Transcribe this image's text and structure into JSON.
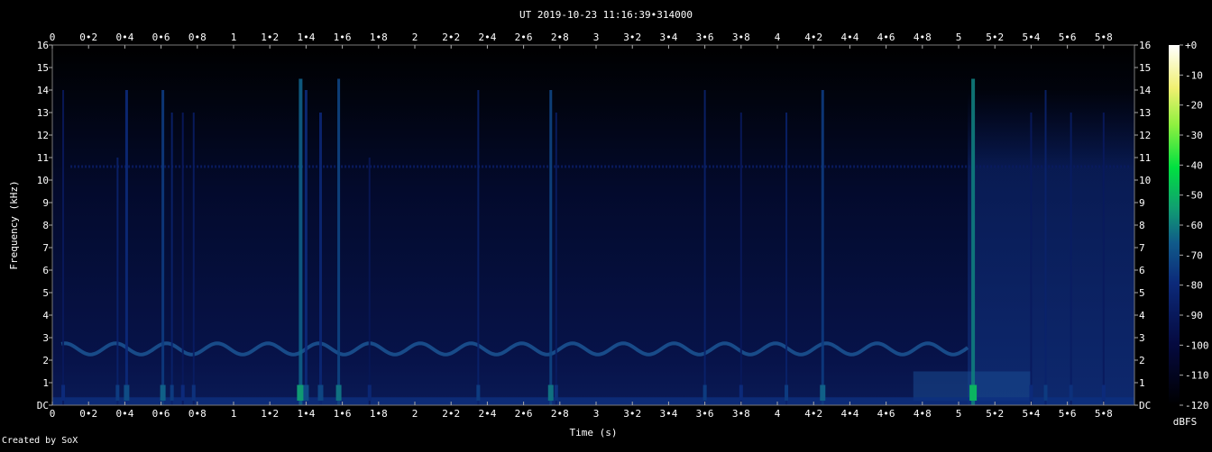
{
  "chart_data": {
    "type": "heatmap",
    "title": "UT 2019-10-23 11:16:39•314000",
    "xlabel": "Time (s)",
    "ylabel": "Frequency (kHz)",
    "xlim": [
      0,
      5.97
    ],
    "ylim": [
      0,
      16
    ],
    "x_ticks": [
      0,
      0.2,
      0.4,
      0.6,
      0.8,
      1,
      1.2,
      1.4,
      1.6,
      1.8,
      2,
      2.2,
      2.4,
      2.6,
      2.8,
      3,
      3.2,
      3.4,
      3.6,
      3.8,
      4,
      4.2,
      4.4,
      4.6,
      4.8,
      5,
      5.2,
      5.4,
      5.6,
      5.8
    ],
    "x_tick_labels": [
      "0",
      "0•2",
      "0•4",
      "0•6",
      "0•8",
      "1",
      "1•2",
      "1•4",
      "1•6",
      "1•8",
      "2",
      "2•2",
      "2•4",
      "2•6",
      "2•8",
      "3",
      "3•2",
      "3•4",
      "3•6",
      "3•8",
      "4",
      "4•2",
      "4•4",
      "4•6",
      "4•8",
      "5",
      "5•2",
      "5•4",
      "5•6",
      "5•8"
    ],
    "y_ticks": [
      0,
      1,
      2,
      3,
      4,
      5,
      6,
      7,
      8,
      9,
      10,
      11,
      12,
      13,
      14,
      15,
      16
    ],
    "y_tick_labels": [
      "DC",
      "1",
      "2",
      "3",
      "4",
      "5",
      "6",
      "7",
      "8",
      "9",
      "10",
      "11",
      "12",
      "13",
      "14",
      "15",
      "16"
    ],
    "colorbar": {
      "label": "dBFS",
      "ticks": [
        0,
        -10,
        -20,
        -30,
        -40,
        -50,
        -60,
        -70,
        -80,
        -90,
        -100,
        -110,
        -120
      ],
      "tick_labels": [
        "+0",
        "-10",
        "-20",
        "-30",
        "-40",
        "-50",
        "-60",
        "-70",
        "-80",
        "-90",
        "-100",
        "-110",
        "-120"
      ],
      "range": [
        -120,
        0
      ]
    },
    "background_level_dbfs": -100,
    "features": {
      "tone_line": {
        "freq_khz": 10.6,
        "t_start": 0.1,
        "t_end": 5.95,
        "level_dbfs": -90
      },
      "wavy_band": {
        "center_khz": 2.5,
        "amplitude_khz": 0.25,
        "period_s": 0.28,
        "t_start": 0.05,
        "t_end": 5.05
      },
      "broadband_region": {
        "t_start": 5.05,
        "t_end": 5.97,
        "f_top_khz": 14,
        "level_dbfs": -95
      },
      "low_band_patch": {
        "t_start": 4.75,
        "t_end": 5.4,
        "f_low_khz": 0.2,
        "f_high_khz": 1.5
      }
    },
    "transients": [
      {
        "t": 0.06,
        "top": 14,
        "level": -90
      },
      {
        "t": 0.36,
        "top": 11,
        "level": -85
      },
      {
        "t": 0.41,
        "top": 14,
        "level": -80
      },
      {
        "t": 0.61,
        "top": 14,
        "level": -75
      },
      {
        "t": 0.66,
        "top": 13,
        "level": -85
      },
      {
        "t": 0.72,
        "top": 13,
        "level": -90
      },
      {
        "t": 0.78,
        "top": 13,
        "level": -88
      },
      {
        "t": 1.37,
        "top": 14.5,
        "level": -65
      },
      {
        "t": 1.4,
        "top": 14,
        "level": -80
      },
      {
        "t": 1.48,
        "top": 13,
        "level": -82
      },
      {
        "t": 1.58,
        "top": 14.5,
        "level": -72
      },
      {
        "t": 1.75,
        "top": 11,
        "level": -92
      },
      {
        "t": 2.35,
        "top": 14,
        "level": -85
      },
      {
        "t": 2.75,
        "top": 14,
        "level": -72
      },
      {
        "t": 2.78,
        "top": 13,
        "level": -88
      },
      {
        "t": 3.6,
        "top": 14,
        "level": -85
      },
      {
        "t": 3.8,
        "top": 13,
        "level": -90
      },
      {
        "t": 4.05,
        "top": 13,
        "level": -85
      },
      {
        "t": 4.25,
        "top": 14,
        "level": -75
      },
      {
        "t": 5.08,
        "top": 14.5,
        "level": -60
      },
      {
        "t": 5.4,
        "top": 13,
        "level": -90
      },
      {
        "t": 5.48,
        "top": 14,
        "level": -85
      },
      {
        "t": 5.62,
        "top": 13,
        "level": -88
      },
      {
        "t": 5.8,
        "top": 13,
        "level": -90
      }
    ]
  },
  "credit": "Created by SoX"
}
